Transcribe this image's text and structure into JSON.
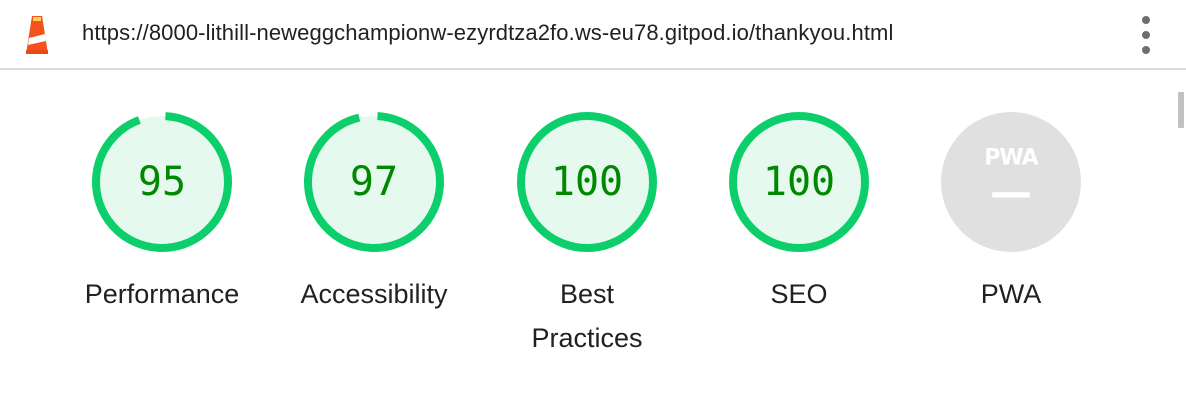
{
  "address_bar": {
    "icon": "lighthouse-icon",
    "url": "https://8000-lithill-neweggchampionw-ezyrdtza2fo.ws-eu78.gitpod.io/thankyou.html",
    "menu_icon": "more-vert-icon"
  },
  "colors": {
    "pass_stroke": "#0cce6b",
    "pass_fill": "#e5f9ee",
    "pass_text": "#008800",
    "na_fill": "#e0e0e0",
    "na_text": "#ffffff"
  },
  "gauges": [
    {
      "label": "Performance",
      "score": "95",
      "value": 95
    },
    {
      "label": "Accessibility",
      "score": "97",
      "value": 97
    },
    {
      "label": "Best Practices",
      "score": "100",
      "value": 100
    },
    {
      "label": "SEO",
      "score": "100",
      "value": 100
    },
    {
      "label": "PWA",
      "badge": "PWA",
      "score_text": "—",
      "icon": "pwa-badge-icon"
    }
  ]
}
